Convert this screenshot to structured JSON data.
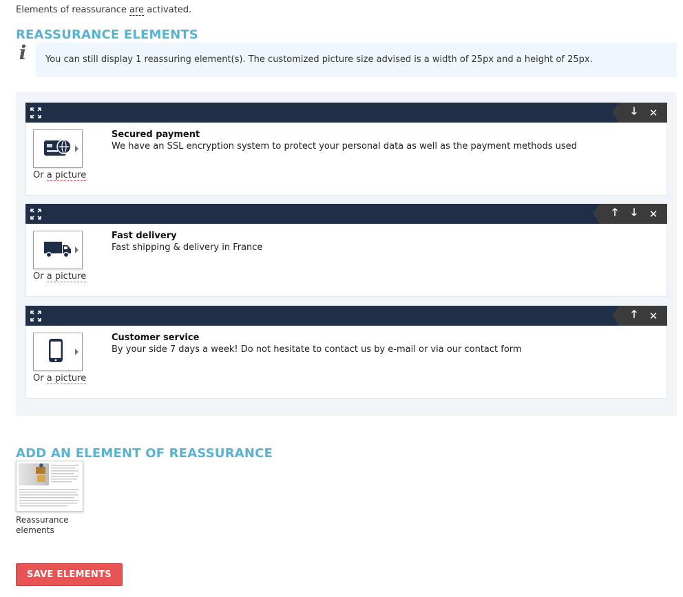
{
  "status": {
    "prefix": "Elements of reassurance ",
    "are": "are",
    "suffix": " activated."
  },
  "reassurance_section": {
    "title": "REASSURANCE ELEMENTS",
    "info_text": "You can still display 1 reassuring element(s). The customized picture size advised is a width of 25px and a height of 25px."
  },
  "elements": [
    {
      "title": "Secured payment",
      "description": "We have an SSL encryption system to protect your personal data as well as the payment methods used",
      "icon": "credit-card-icon",
      "or_text": "Or ",
      "picture_link": "a picture"
    },
    {
      "title": "Fast delivery",
      "description": "Fast shipping & delivery in France",
      "icon": "truck-icon",
      "or_text": "Or ",
      "picture_link": "a picture"
    },
    {
      "title": "Customer service",
      "description": "By your side 7 days a week! Do not hesitate to contact us by e-mail or via our contact form",
      "icon": "smartphone-icon",
      "or_text": "Or ",
      "picture_link": "a picture"
    }
  ],
  "actions": {
    "up": "🡑",
    "down": "🡓",
    "close": "✕"
  },
  "add_section": {
    "title": "ADD AN ELEMENT OF REASSURANCE",
    "template_label": "Reassurance elements"
  },
  "save_button": "SAVE ELEMENTS",
  "colors": {
    "accent": "#58b3d3",
    "header": "#1e2f47",
    "save": "#e85454"
  }
}
